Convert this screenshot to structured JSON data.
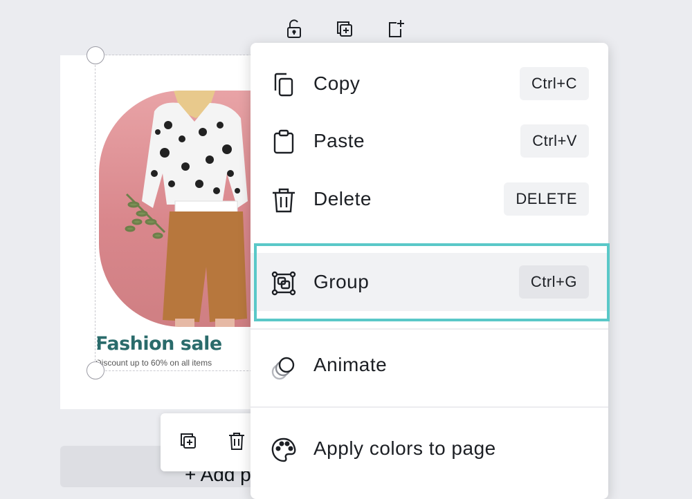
{
  "top_toolbar": {
    "lock_icon": "lock-icon",
    "duplicate_icon": "duplicate-icon",
    "add_page_icon": "add-page-icon"
  },
  "design": {
    "title": "Fashion sale",
    "subtitle": "Discount up to 60% on all items"
  },
  "floating_toolbar": {
    "duplicate_icon": "duplicate-icon",
    "delete_icon": "trash-icon"
  },
  "add_page": {
    "label": "+ Add page"
  },
  "context_menu": {
    "items": [
      {
        "label": "Copy",
        "shortcut": "Ctrl+C",
        "icon": "copy-icon"
      },
      {
        "label": "Paste",
        "shortcut": "Ctrl+V",
        "icon": "paste-icon"
      },
      {
        "label": "Delete",
        "shortcut": "DELETE",
        "icon": "trash-icon"
      },
      {
        "label": "Group",
        "shortcut": "Ctrl+G",
        "icon": "group-icon"
      },
      {
        "label": "Animate",
        "shortcut": "",
        "icon": "animate-icon"
      },
      {
        "label": "Apply colors to page",
        "shortcut": "",
        "icon": "palette-icon"
      }
    ],
    "highlighted_item": "Group"
  },
  "colors": {
    "highlight_border": "#5ac8c8",
    "title_text": "#2a6b6b",
    "photo_background": "#d9878c"
  }
}
